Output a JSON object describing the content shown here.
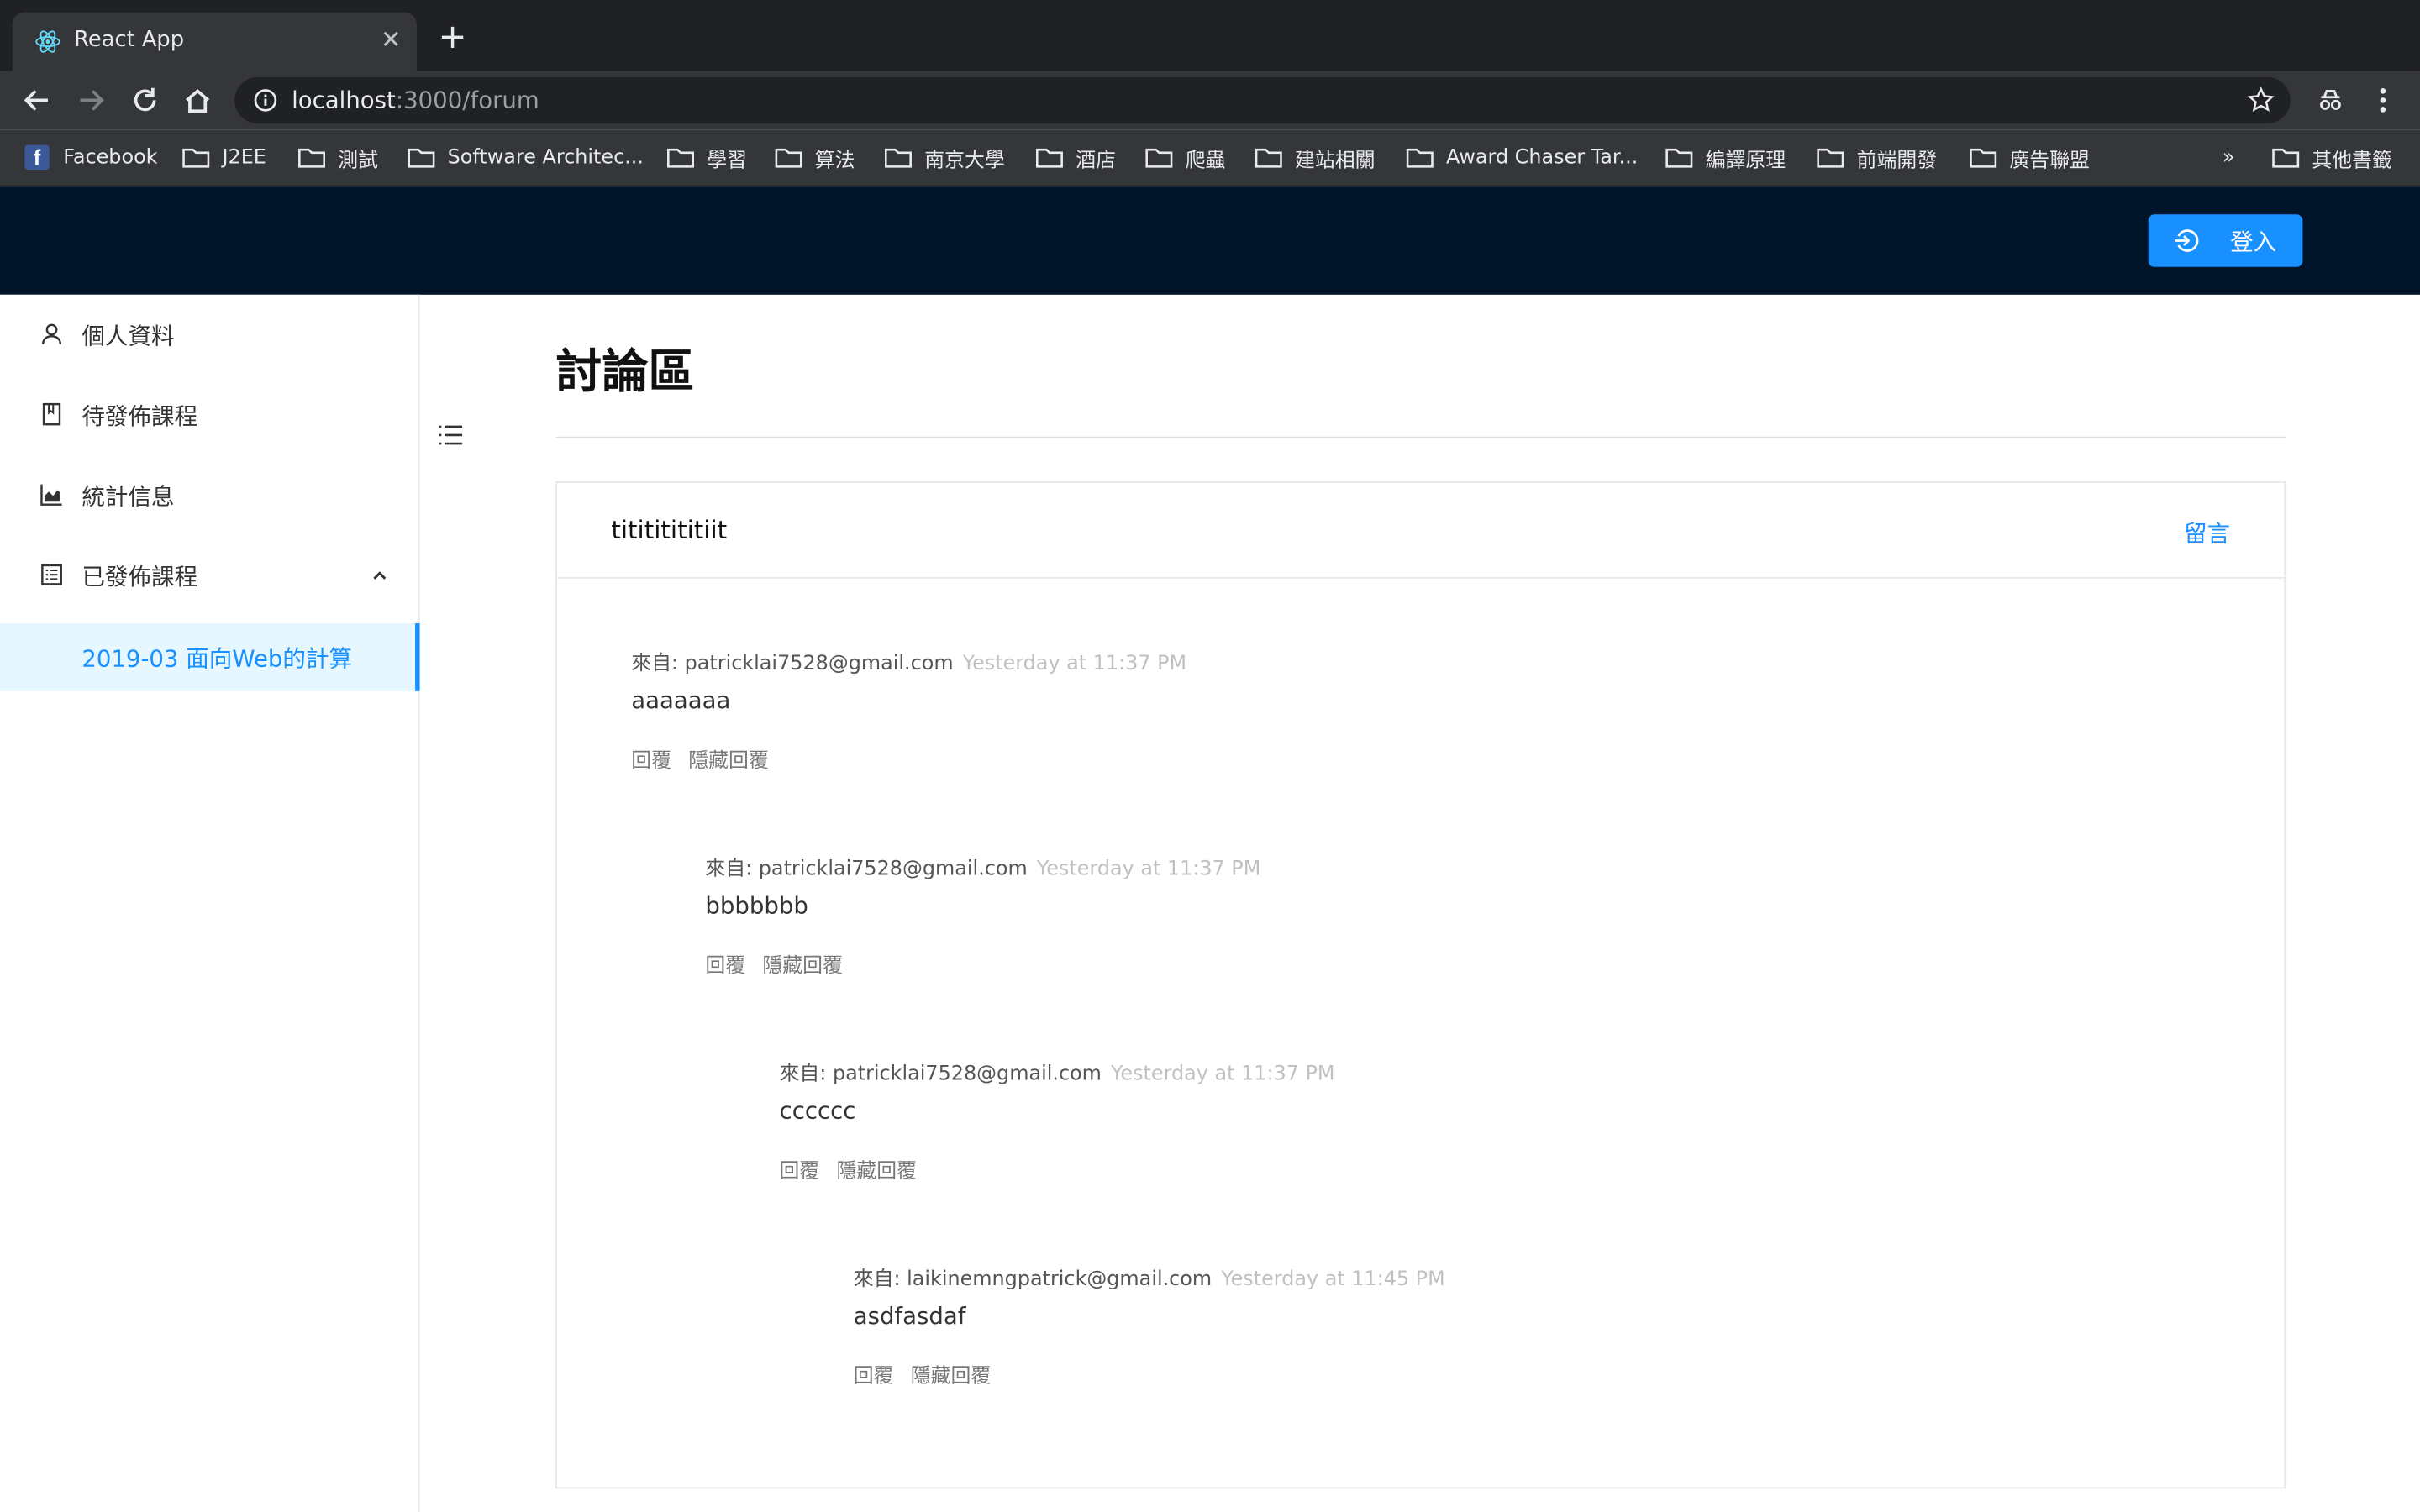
{
  "browser": {
    "tab_title": "React App",
    "url_host": "localhost",
    "url_rest": ":3000/forum",
    "bookmarks": [
      "Facebook",
      "J2EE",
      "測試",
      "Software Architec...",
      "學習",
      "算法",
      "南京大學",
      "酒店",
      "爬蟲",
      "建站相關",
      "Award Chaser Tar...",
      "編譯原理",
      "前端開發",
      "廣告聯盟"
    ],
    "more_bookmarks": "»",
    "other_bookmarks": "其他書籤"
  },
  "header": {
    "login_label": "登入",
    "accent": "#1890ff",
    "background": "#001529"
  },
  "sidebar": {
    "items": [
      {
        "label": "個人資料",
        "icon": "user-icon"
      },
      {
        "label": "待發佈課程",
        "icon": "book-icon"
      },
      {
        "label": "統計信息",
        "icon": "area-chart-icon"
      },
      {
        "label": "已發佈課程",
        "icon": "profile-icon"
      }
    ],
    "sub_item": "2019-03 面向Web的計算"
  },
  "page": {
    "title": "討論區",
    "card_title": "titititititiit",
    "card_action": "留言"
  },
  "comments": [
    {
      "from_label": "來自: patricklai7528@gmail.com",
      "time": "Yesterday at 11:37 PM",
      "body": "aaaaaaa",
      "reply": "回覆",
      "hide": "隱藏回覆"
    },
    {
      "from_label": "來自: patricklai7528@gmail.com",
      "time": "Yesterday at 11:37 PM",
      "body": "bbbbbbb",
      "reply": "回覆",
      "hide": "隱藏回覆"
    },
    {
      "from_label": "來自: patricklai7528@gmail.com",
      "time": "Yesterday at 11:37 PM",
      "body": "cccccc",
      "reply": "回覆",
      "hide": "隱藏回覆"
    },
    {
      "from_label": "來自: laikinemngpatrick@gmail.com",
      "time": "Yesterday at 11:45 PM",
      "body": "asdfasdaf",
      "reply": "回覆",
      "hide": "隱藏回覆"
    }
  ]
}
